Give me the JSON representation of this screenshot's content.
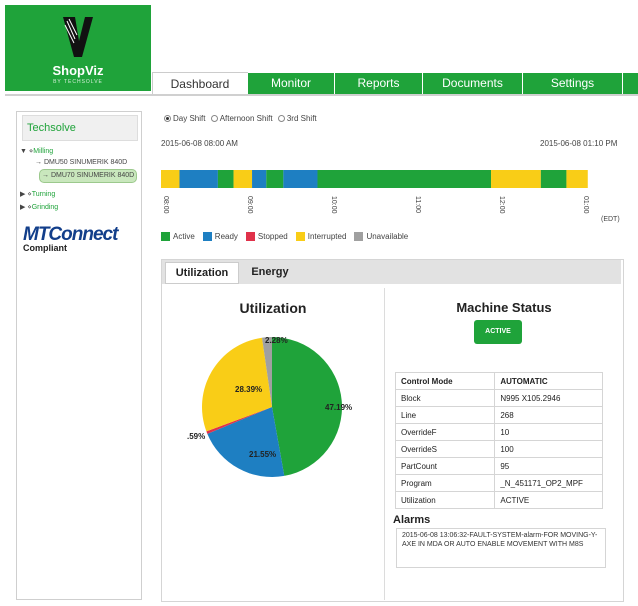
{
  "app": {
    "name": "ShopViz",
    "tagline": "BY TECHSOLVE",
    "brand_color": "#1fa33a"
  },
  "nav": {
    "tabs": [
      {
        "label": "Dashboard",
        "active": true
      },
      {
        "label": "Monitor"
      },
      {
        "label": "Reports"
      },
      {
        "label": "Documents"
      },
      {
        "label": "Settings"
      }
    ]
  },
  "sidebar": {
    "title": "Techsolve",
    "tree": [
      {
        "label": "Milling",
        "expanded": true,
        "children": [
          "DMU50 SINUMERIK 840D",
          "DMU70 SINUMERIK 840D"
        ],
        "selected": "DMU70 SINUMERIK 840D"
      },
      {
        "label": "Turning",
        "expanded": false
      },
      {
        "label": "Grinding",
        "expanded": false
      }
    ],
    "mtconnect": {
      "line1": "MTConnect",
      "line2": "Compliant"
    }
  },
  "shifts": {
    "options": [
      "Day Shift",
      "Afternoon Shift",
      "3rd Shift"
    ],
    "selected": "Day Shift"
  },
  "timeline": {
    "start": "2015-06-08 08:00 AM",
    "end": "2015-06-08 01:10 PM",
    "ticks": [
      "08:00",
      "09:00",
      "10:00",
      "11:00",
      "12:00",
      "01:00"
    ],
    "timezone": "(EDT)",
    "segments": [
      {
        "state": "Interrupted",
        "start": "08:00",
        "end": "08:13"
      },
      {
        "state": "Ready",
        "start": "08:13",
        "end": "08:40"
      },
      {
        "state": "Active",
        "start": "08:40",
        "end": "08:51"
      },
      {
        "state": "Interrupted",
        "start": "08:51",
        "end": "09:04"
      },
      {
        "state": "Ready",
        "start": "09:04",
        "end": "09:14"
      },
      {
        "state": "Active",
        "start": "09:14",
        "end": "09:26"
      },
      {
        "state": "Ready",
        "start": "09:26",
        "end": "09:50"
      },
      {
        "state": "Active",
        "start": "09:50",
        "end": "11:52"
      },
      {
        "state": "Interrupted",
        "start": "11:52",
        "end": "12:27"
      },
      {
        "state": "Active",
        "start": "12:27",
        "end": "12:45"
      },
      {
        "state": "Interrupted",
        "start": "12:45",
        "end": "13:00"
      }
    ]
  },
  "legend": [
    {
      "label": "Active",
      "color": "#1fa33a"
    },
    {
      "label": "Ready",
      "color": "#1e7fc2"
    },
    {
      "label": "Stopped",
      "color": "#e0314a"
    },
    {
      "label": "Interrupted",
      "color": "#f9cd17"
    },
    {
      "label": "Unavailable",
      "color": "#a0a0a0"
    }
  ],
  "panel_tabs": [
    {
      "label": "Utilization",
      "active": true
    },
    {
      "label": "Energy"
    }
  ],
  "utilization": {
    "title": "Utilization",
    "chart_data": {
      "type": "pie",
      "slices": [
        {
          "label": "47.19%",
          "value": 47.19,
          "state": "Active",
          "color": "#1fa33a"
        },
        {
          "label": "21.55%",
          "value": 21.55,
          "state": "Ready",
          "color": "#1e7fc2"
        },
        {
          "label": ".59%",
          "value": 0.59,
          "state": "Stopped",
          "color": "#e0314a"
        },
        {
          "label": "28.39%",
          "value": 28.39,
          "state": "Interrupted",
          "color": "#f9cd17"
        },
        {
          "label": "2.28%",
          "value": 2.28,
          "state": "Unavailable",
          "color": "#a0a0a0"
        }
      ]
    }
  },
  "machine_status": {
    "title": "Machine Status",
    "badge": "ACTIVE",
    "rows": [
      {
        "key": "Control Mode",
        "value": "AUTOMATIC"
      },
      {
        "key": "Block",
        "value": "N995 X105.2946"
      },
      {
        "key": "Line",
        "value": "268"
      },
      {
        "key": "OverrideF",
        "value": "10"
      },
      {
        "key": "OverrideS",
        "value": "100"
      },
      {
        "key": "PartCount",
        "value": "95"
      },
      {
        "key": "Program",
        "value": "_N_451171_OP2_MPF"
      },
      {
        "key": "Utilization",
        "value": "ACTIVE"
      }
    ]
  },
  "alarms": {
    "title": "Alarms",
    "text": "2015-06-08 13:06:32-FAULT-SYSTEM-alarm-FOR MOVING-Y-AXE IN MDA OR AUTO ENABLE MOVEMENT WITH M8S"
  }
}
